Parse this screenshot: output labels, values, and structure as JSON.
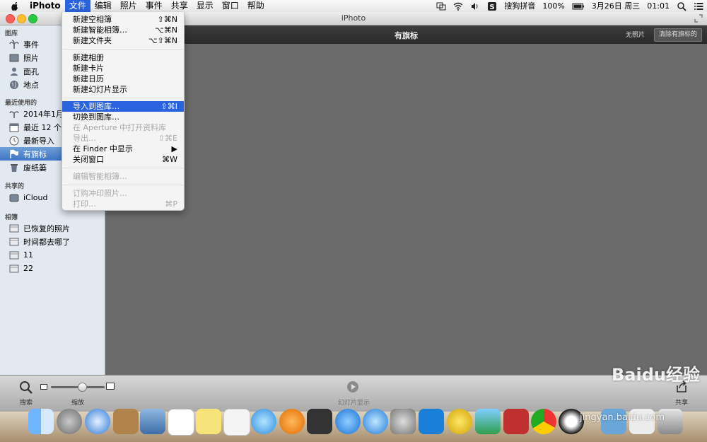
{
  "menubar": {
    "app": "iPhoto",
    "menus": [
      "文件",
      "编辑",
      "照片",
      "事件",
      "共享",
      "显示",
      "窗口",
      "帮助"
    ],
    "status": {
      "input_method": "搜狗拼音",
      "battery": "100%",
      "date": "3月26日 周三",
      "time": "01:01"
    }
  },
  "window": {
    "title": "iPhoto"
  },
  "sidebar": {
    "sections": [
      "图库",
      "最近使用的",
      "共享的",
      "相簿"
    ],
    "library": [
      "事件",
      "照片",
      "面孔",
      "地点"
    ],
    "recent": [
      "2014年1月2",
      "最近 12 个月",
      "最新导入",
      "有旗标",
      "废纸篓"
    ],
    "shared": [
      "iCloud"
    ],
    "albums": [
      "已恢复的照片",
      "时间都去哪了",
      "11",
      "22"
    ]
  },
  "main": {
    "title": "有旗标",
    "no_photos": "无照片",
    "clear_button": "清除有旗标的"
  },
  "bottom": {
    "search": "搜索",
    "zoom": "缩放",
    "slideshow": "幻灯片显示",
    "share": "共享"
  },
  "file_menu": {
    "items": [
      {
        "label": "新建空相簿",
        "shortcut": "⇧⌘N"
      },
      {
        "label": "新建智能相簿…",
        "shortcut": "⌥⌘N"
      },
      {
        "label": "新建文件夹",
        "shortcut": "⌥⇧⌘N"
      },
      {
        "label": "新建相册",
        "shortcut": ""
      },
      {
        "label": "新建卡片",
        "shortcut": ""
      },
      {
        "label": "新建日历",
        "shortcut": ""
      },
      {
        "label": "新建幻灯片显示",
        "shortcut": ""
      },
      {
        "label": "导入到图库…",
        "shortcut": "⇧⌘I"
      },
      {
        "label": "切换到图库…",
        "shortcut": ""
      },
      {
        "label": "在 Aperture 中打开资料库",
        "shortcut": ""
      },
      {
        "label": "导出…",
        "shortcut": "⇧⌘E"
      },
      {
        "label": "在 Finder 中显示",
        "shortcut": "▶"
      },
      {
        "label": "关闭窗口",
        "shortcut": "⌘W"
      },
      {
        "label": "编辑智能相簿…",
        "shortcut": ""
      },
      {
        "label": "订购冲印照片…",
        "shortcut": ""
      },
      {
        "label": "打印…",
        "shortcut": "⌘P"
      }
    ]
  },
  "watermark": {
    "brand": "Baidu经验",
    "url": "jingyan.baidu.com"
  },
  "colors": {
    "highlight": "#2b62de",
    "sidebar_selected": "#3c75c6",
    "content_bg": "#6b6b6b"
  }
}
